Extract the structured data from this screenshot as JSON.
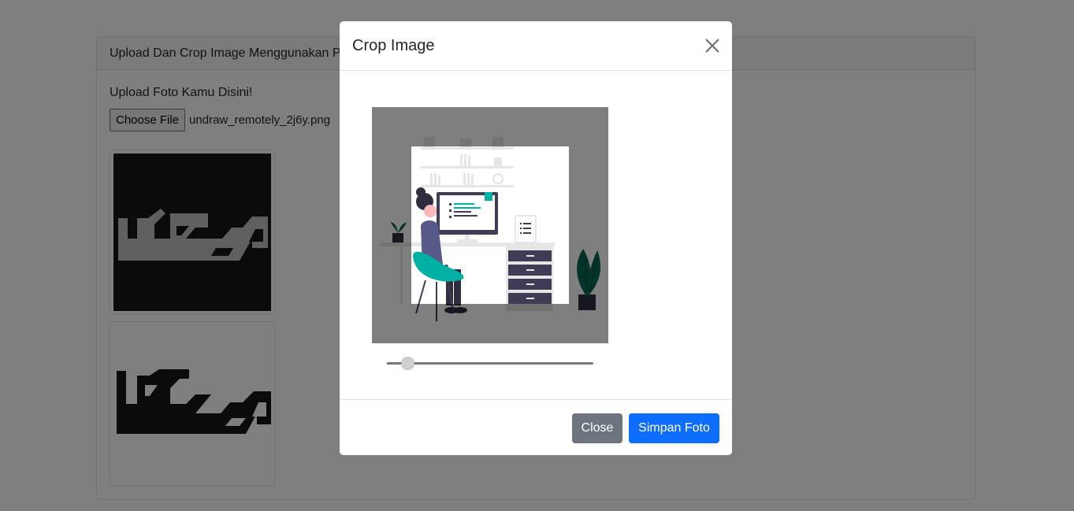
{
  "page": {
    "card_title": "Upload Dan Crop Image Menggunakan PHP dan JavaScript",
    "upload_label": "Upload Foto Kamu Disini!",
    "file_button_label": "Choose File",
    "file_name": "undraw_remotely_2j6y.png"
  },
  "modal": {
    "title": "Crop Image",
    "close_button_label": "Close",
    "save_button_label": "Simpan Foto",
    "zoom_level": 0.1
  },
  "icons": {
    "close": "close-icon"
  },
  "colors": {
    "primary": "#0d6efd",
    "secondary": "#6c757d",
    "accent_teal": "#00b0a4",
    "plant_green": "#086654"
  }
}
